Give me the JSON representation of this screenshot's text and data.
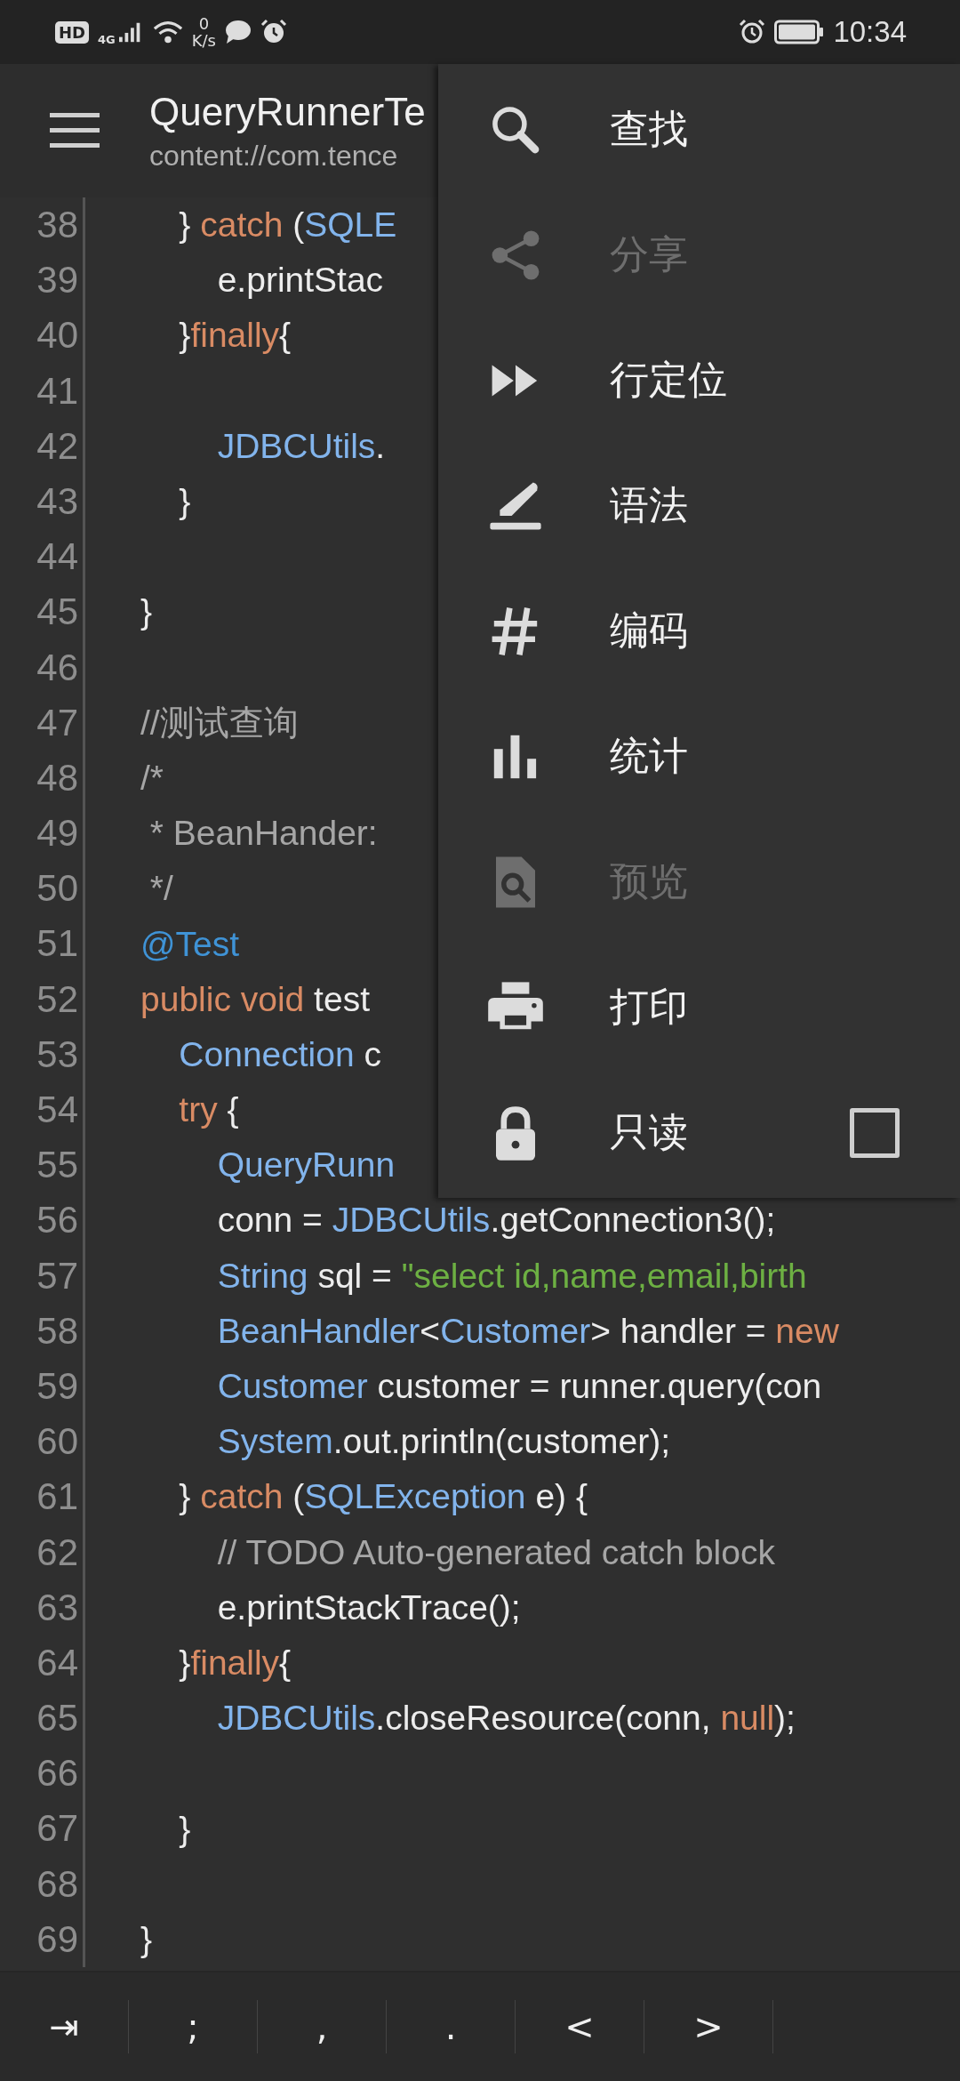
{
  "status_bar": {
    "network_badge": "HD",
    "network_type": "4G",
    "speed_value": "0",
    "speed_unit": "K/s",
    "time": "10:34"
  },
  "toolbar": {
    "title": "QueryRunnerTe",
    "subtitle": "content://com.tence"
  },
  "code_lines": [
    {
      "number": "38",
      "tokens": [
        {
          "text": "    } ",
          "kind": "plain"
        },
        {
          "text": "catch",
          "kind": "keyword"
        },
        {
          "text": " (",
          "kind": "plain"
        },
        {
          "text": "SQLE",
          "kind": "type"
        }
      ]
    },
    {
      "number": "39",
      "tokens": [
        {
          "text": "        e.printStac",
          "kind": "plain"
        }
      ]
    },
    {
      "number": "40",
      "tokens": [
        {
          "text": "    }",
          "kind": "plain"
        },
        {
          "text": "finally",
          "kind": "keyword"
        },
        {
          "text": "{",
          "kind": "plain"
        }
      ]
    },
    {
      "number": "41"
    },
    {
      "number": "42",
      "tokens": [
        {
          "text": "        JDBCUtils",
          "kind": "type"
        },
        {
          "text": ".",
          "kind": "plain"
        }
      ]
    },
    {
      "number": "43",
      "tokens": [
        {
          "text": "    }",
          "kind": "plain"
        }
      ]
    },
    {
      "number": "44"
    },
    {
      "number": "45",
      "tokens": [
        {
          "text": "}",
          "kind": "plain"
        }
      ]
    },
    {
      "number": "46"
    },
    {
      "number": "47",
      "tokens": [
        {
          "text": "//测试查询",
          "kind": "comment"
        }
      ]
    },
    {
      "number": "48",
      "tokens": [
        {
          "text": "/*",
          "kind": "comment"
        }
      ]
    },
    {
      "number": "49",
      "tokens": [
        {
          "text": " * BeanHander:",
          "kind": "comment"
        }
      ]
    },
    {
      "number": "50",
      "tokens": [
        {
          "text": " */",
          "kind": "comment"
        }
      ]
    },
    {
      "number": "51",
      "tokens": [
        {
          "text": "@Test",
          "kind": "annotation"
        }
      ]
    },
    {
      "number": "52",
      "tokens": [
        {
          "text": "public void",
          "kind": "keyword"
        },
        {
          "text": " test",
          "kind": "plain"
        }
      ]
    },
    {
      "number": "53",
      "tokens": [
        {
          "text": "    Connection",
          "kind": "type"
        },
        {
          "text": " c",
          "kind": "plain"
        }
      ]
    },
    {
      "number": "54",
      "tokens": [
        {
          "text": "    try",
          "kind": "keyword"
        },
        {
          "text": " {",
          "kind": "plain"
        }
      ]
    },
    {
      "number": "55",
      "tokens": [
        {
          "text": "        QueryRunn",
          "kind": "type"
        }
      ]
    },
    {
      "number": "56",
      "tokens": [
        {
          "text": "        conn = ",
          "kind": "plain"
        },
        {
          "text": "JDBCUtils",
          "kind": "type"
        },
        {
          "text": ".getConnection3();",
          "kind": "plain"
        }
      ]
    },
    {
      "number": "57",
      "tokens": [
        {
          "text": "        String",
          "kind": "type"
        },
        {
          "text": " sql = ",
          "kind": "plain"
        },
        {
          "text": "\"select id,name,email,birth",
          "kind": "string"
        }
      ]
    },
    {
      "number": "58",
      "tokens": [
        {
          "text": "        BeanHandler",
          "kind": "type"
        },
        {
          "text": "<",
          "kind": "plain"
        },
        {
          "text": "Customer",
          "kind": "type"
        },
        {
          "text": "> handler = ",
          "kind": "plain"
        },
        {
          "text": "new",
          "kind": "keyword"
        }
      ]
    },
    {
      "number": "59",
      "tokens": [
        {
          "text": "        Customer",
          "kind": "type"
        },
        {
          "text": " customer = runner.query(con",
          "kind": "plain"
        }
      ]
    },
    {
      "number": "60",
      "tokens": [
        {
          "text": "        System",
          "kind": "type"
        },
        {
          "text": ".out.println(customer);",
          "kind": "plain"
        }
      ]
    },
    {
      "number": "61",
      "tokens": [
        {
          "text": "    } ",
          "kind": "plain"
        },
        {
          "text": "catch",
          "kind": "keyword"
        },
        {
          "text": " (",
          "kind": "plain"
        },
        {
          "text": "SQLException",
          "kind": "type"
        },
        {
          "text": " e) {",
          "kind": "plain"
        }
      ]
    },
    {
      "number": "62",
      "tokens": [
        {
          "text": "        // TODO Auto-generated catch block",
          "kind": "comment"
        }
      ]
    },
    {
      "number": "63",
      "tokens": [
        {
          "text": "        e.printStackTrace();",
          "kind": "plain"
        }
      ]
    },
    {
      "number": "64",
      "tokens": [
        {
          "text": "    }",
          "kind": "plain"
        },
        {
          "text": "finally",
          "kind": "keyword"
        },
        {
          "text": "{",
          "kind": "plain"
        }
      ]
    },
    {
      "number": "65",
      "tokens": [
        {
          "text": "        JDBCUtils",
          "kind": "type"
        },
        {
          "text": ".closeResource(conn, ",
          "kind": "plain"
        },
        {
          "text": "null",
          "kind": "keyword"
        },
        {
          "text": ");",
          "kind": "plain"
        }
      ]
    },
    {
      "number": "66"
    },
    {
      "number": "67",
      "tokens": [
        {
          "text": "    }",
          "kind": "plain"
        }
      ]
    },
    {
      "number": "68"
    },
    {
      "number": "69",
      "tokens": [
        {
          "text": "}",
          "kind": "plain"
        }
      ]
    }
  ],
  "menu": [
    {
      "label": "查找",
      "disabled": false
    },
    {
      "label": "分享",
      "disabled": true
    },
    {
      "label": "行定位",
      "disabled": false
    },
    {
      "label": "语法",
      "disabled": false
    },
    {
      "label": "编码",
      "disabled": false
    },
    {
      "label": "统计",
      "disabled": false
    },
    {
      "label": "预览",
      "disabled": true
    },
    {
      "label": "打印",
      "disabled": false
    },
    {
      "label": "只读",
      "disabled": false,
      "checked": false
    }
  ],
  "symbol_keys": [
    "⇥",
    ";",
    ",",
    ".",
    "<",
    ">"
  ]
}
